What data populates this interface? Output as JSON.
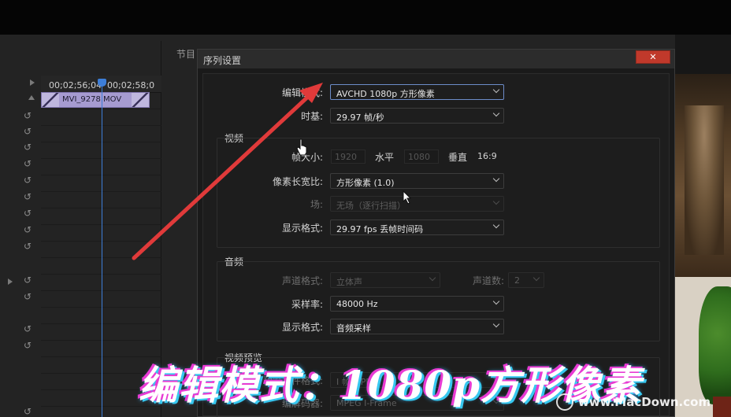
{
  "timeline": {
    "timecode_left": "00;02;56;04",
    "timecode_right": "00;02;58;0",
    "clip_name": "MVI_9278.MOV",
    "program_tab_label": "节目"
  },
  "dialog": {
    "title": "序列设置",
    "close_label": "✕",
    "edit_mode": {
      "label": "编辑模式:",
      "value": "AVCHD 1080p 方形像素"
    },
    "timebase": {
      "label": "时基:",
      "value": "29.97  帧/秒"
    },
    "video": {
      "section_title": "视频",
      "frame_size_label": "帧大小:",
      "frame_width": "1920",
      "horizontal_label": "水平",
      "frame_height": "1080",
      "vertical_label": "垂直",
      "aspect": "16:9",
      "pixel_aspect": {
        "label": "像素长宽比:",
        "value": "方形像素 (1.0)"
      },
      "field": {
        "label": "场:",
        "value": "无场（逐行扫描）"
      },
      "display_format": {
        "label": "显示格式:",
        "value": "29.97 fps 丢帧时间码"
      }
    },
    "audio": {
      "section_title": "音频",
      "channel_format": {
        "label": "声道格式:",
        "value": "立体声"
      },
      "channel_count": {
        "label": "声道数:",
        "value": "2"
      },
      "sample_rate": {
        "label": "采样率:",
        "value": "48000 Hz"
      },
      "display_format": {
        "label": "显示格式:",
        "value": "音频采样"
      }
    },
    "preview": {
      "section_title": "视频预览",
      "preview_format": {
        "label": "预览文件格式:",
        "value": "I 帧 MPEG"
      },
      "codec": {
        "label": "编解码器:",
        "value": "MPEG I-Frame"
      }
    }
  },
  "caption": "编辑模式：1080p方形像素",
  "watermark": "www.MacDown.com",
  "colors": {
    "arrow": "#e03a3a",
    "playhead": "#3d7ed8",
    "clip": "#a69bd0",
    "close_button": "#c0392b",
    "caption_outline_pink": "#e83ad3",
    "caption_outline_cyan": "#37c8f0"
  },
  "icons": {
    "track_toggle": "sync-lock-icon",
    "cursor": "hand-pointer-icon"
  }
}
